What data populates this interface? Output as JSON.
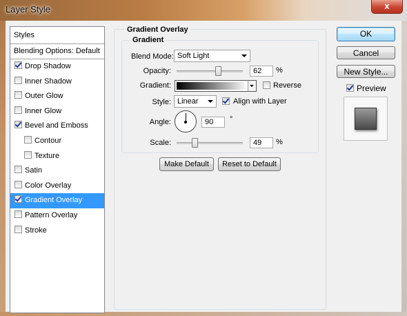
{
  "window": {
    "title": "Layer Style",
    "close_glyph": "x"
  },
  "styles_panel": {
    "header": "Styles",
    "blending_options": "Blending Options: Default",
    "items": [
      {
        "label": "Drop Shadow",
        "checked": true,
        "indent": false,
        "selected": false
      },
      {
        "label": "Inner Shadow",
        "checked": false,
        "indent": false,
        "selected": false
      },
      {
        "label": "Outer Glow",
        "checked": false,
        "indent": false,
        "selected": false
      },
      {
        "label": "Inner Glow",
        "checked": false,
        "indent": false,
        "selected": false
      },
      {
        "label": "Bevel and Emboss",
        "checked": true,
        "indent": false,
        "selected": false
      },
      {
        "label": "Contour",
        "checked": false,
        "indent": true,
        "selected": false
      },
      {
        "label": "Texture",
        "checked": false,
        "indent": true,
        "selected": false
      },
      {
        "label": "Satin",
        "checked": false,
        "indent": false,
        "selected": false
      },
      {
        "label": "Color Overlay",
        "checked": false,
        "indent": false,
        "selected": false
      },
      {
        "label": "Gradient Overlay",
        "checked": true,
        "indent": false,
        "selected": true
      },
      {
        "label": "Pattern Overlay",
        "checked": false,
        "indent": false,
        "selected": false
      },
      {
        "label": "Stroke",
        "checked": false,
        "indent": false,
        "selected": false
      }
    ]
  },
  "gradient_overlay": {
    "section_title": "Gradient Overlay",
    "group_title": "Gradient",
    "blend_mode_label": "Blend Mode:",
    "blend_mode_value": "Soft Light",
    "opacity_label": "Opacity:",
    "opacity_value": "62",
    "opacity_unit": "%",
    "opacity_level": 0.62,
    "gradient_label": "Gradient:",
    "reverse_label": "Reverse",
    "reverse_checked": false,
    "style_label": "Style:",
    "style_value": "Linear",
    "align_label": "Align with Layer",
    "align_checked": true,
    "angle_label": "Angle:",
    "angle_value": "90",
    "angle_unit": "°",
    "scale_label": "Scale:",
    "scale_value": "49",
    "scale_unit": "%",
    "scale_level": 0.49,
    "make_default": "Make Default",
    "reset_default": "Reset to Default"
  },
  "actions": {
    "ok": "OK",
    "cancel": "Cancel",
    "new_style": "New Style...",
    "preview_label": "Preview",
    "preview_checked": true
  },
  "colors": {
    "selection": "#3399ff",
    "close_button": "#c8452f"
  }
}
